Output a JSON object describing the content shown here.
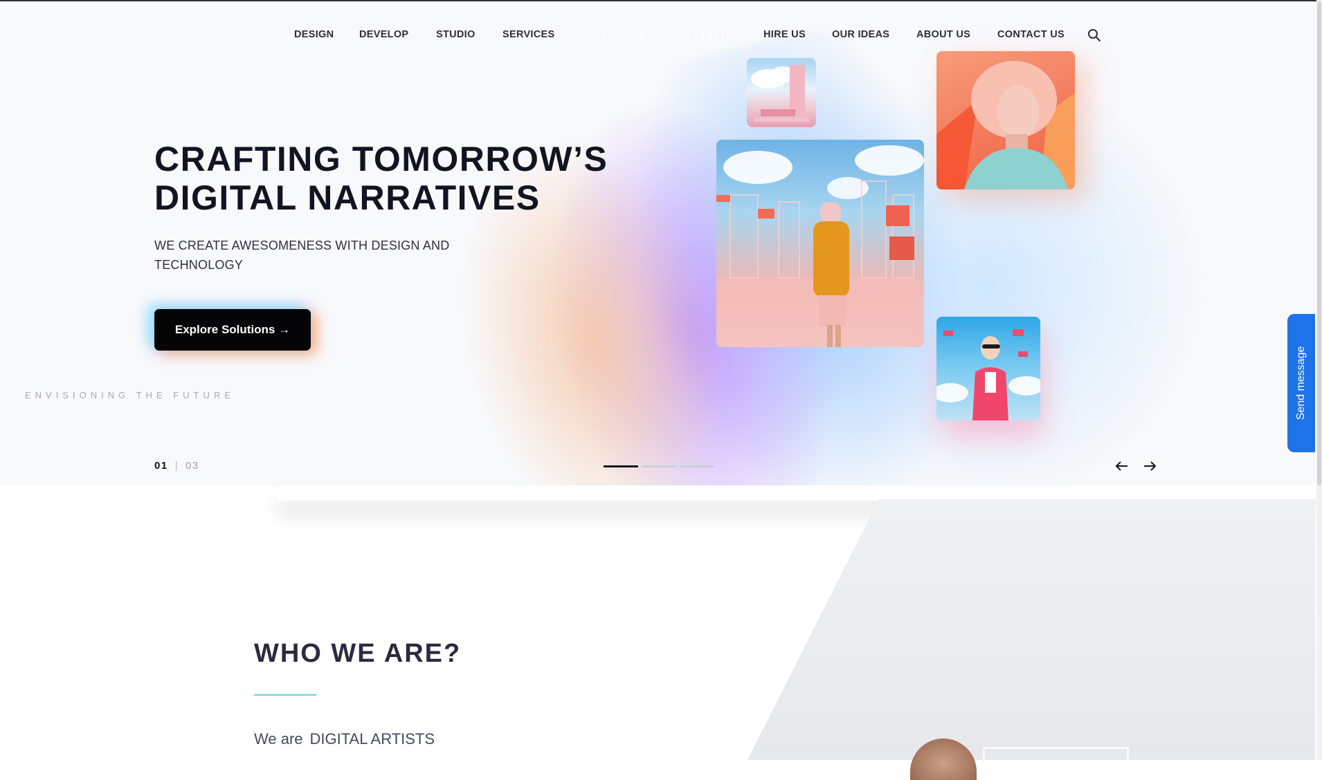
{
  "nav": {
    "left": [
      "DESIGN",
      "DEVELOP",
      "STUDIO",
      "SERVICES"
    ],
    "logo": "PIXEL SOLUTIONS",
    "right": [
      "HIRE US",
      "OUR IDEAS",
      "ABOUT US",
      "CONTACT US"
    ],
    "search_icon": "search-icon"
  },
  "hero": {
    "title_line1": "CRAFTING TOMORROW’S",
    "title_line2": "DIGITAL NARRATIVES",
    "subtitle": "WE CREATE AWESOMENESS WITH DESIGN AND TECHNOLOGY",
    "cta_label": "Explore Solutions",
    "cta_icon": "→",
    "tagline": "ENVISIONING THE FUTURE",
    "slide_current": "01",
    "slide_separator": "|",
    "slide_total": "03",
    "slide_count": 3,
    "active_slide_index": 0,
    "prev_icon": "arrow-left-icon",
    "next_icon": "arrow-right-icon"
  },
  "send_message": "Send message",
  "about": {
    "title": "WHO WE ARE?",
    "text_prefix": "We are",
    "text_highlight": "DIGITAL ARTISTS"
  },
  "colors": {
    "cta_bg": "#050507",
    "accent_line": "#5fd3de",
    "send_tab": "#1f73e8",
    "dot_active": "#14161d",
    "dot_inactive": "#c9cfdb"
  }
}
